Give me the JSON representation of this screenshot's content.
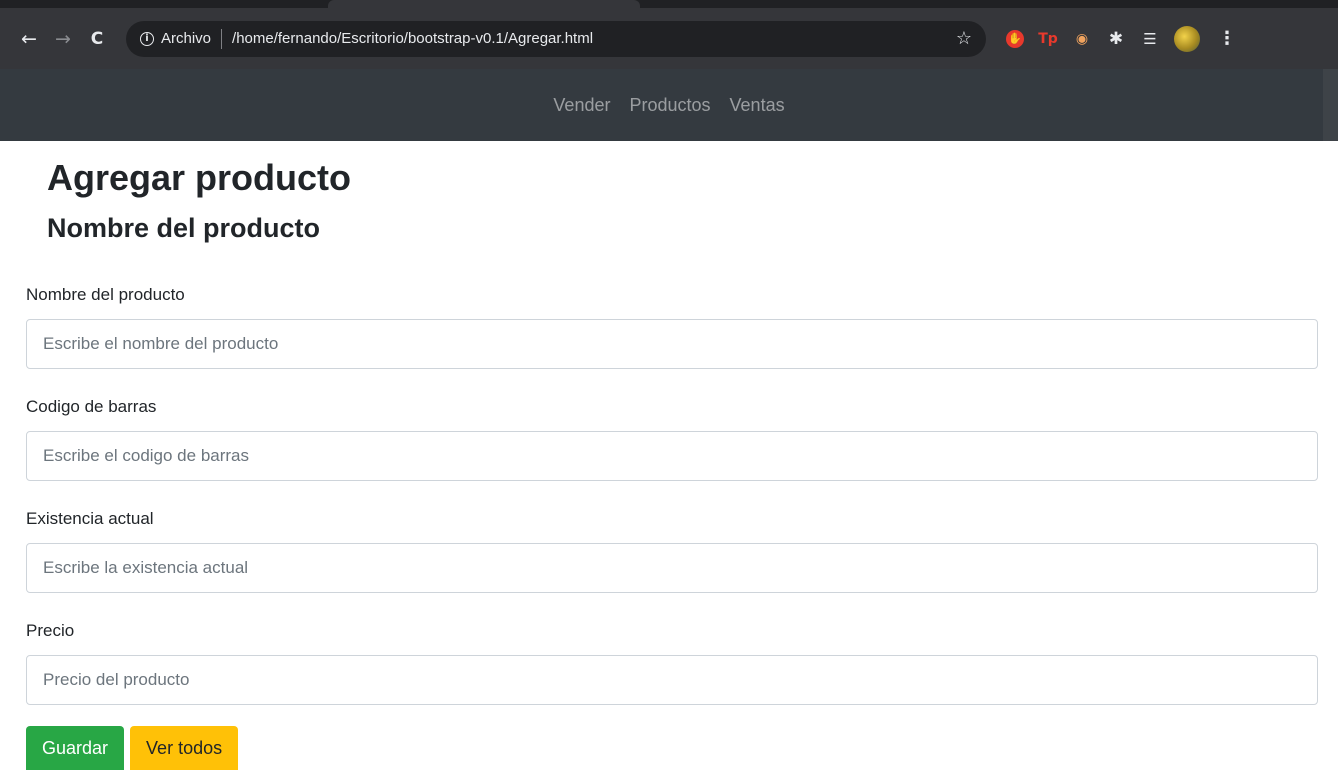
{
  "browser": {
    "nav": {
      "back": "←",
      "forward": "→",
      "reload": "C"
    },
    "address": {
      "scheme_label": "Archivo",
      "url": "/home/fernando/Escritorio/bootstrap-v0.1/Agregar.html"
    },
    "icons": [
      "info-icon",
      "star-icon",
      "stop-icon",
      "tp-icon",
      "eyes-icon",
      "puzzle-icon",
      "media-icon",
      "avatar",
      "menu-icon"
    ],
    "extensions": {
      "tp_label": "Tp"
    }
  },
  "navbar": {
    "items": [
      {
        "label": "Vender"
      },
      {
        "label": "Productos"
      },
      {
        "label": "Ventas"
      }
    ]
  },
  "page": {
    "title": "Agregar producto",
    "subtitle": "Nombre del producto"
  },
  "form": {
    "fields": [
      {
        "label": "Nombre del producto",
        "placeholder": "Escribe el nombre del producto",
        "value": ""
      },
      {
        "label": "Codigo de barras",
        "placeholder": "Escribe el codigo de barras",
        "value": ""
      },
      {
        "label": "Existencia actual",
        "placeholder": "Escribe la existencia actual",
        "value": ""
      },
      {
        "label": "Precio",
        "placeholder": "Precio del producto",
        "value": ""
      }
    ],
    "buttons": {
      "save_label": "Guardar",
      "view_all_label": "Ver todos"
    }
  },
  "colors": {
    "navbar_bg": "#343a40",
    "success": "#28a745",
    "warning": "#ffc107"
  }
}
